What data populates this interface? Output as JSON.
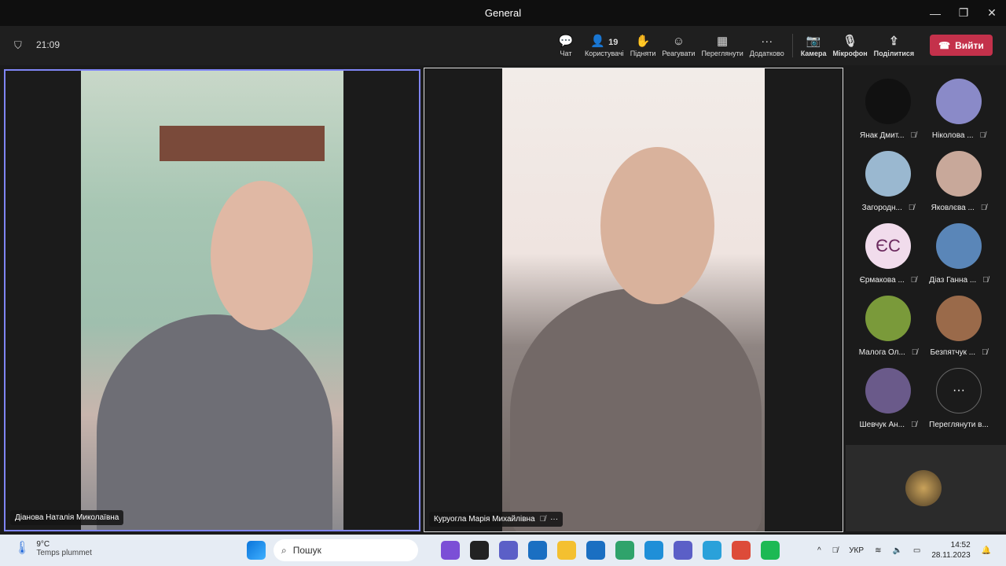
{
  "window": {
    "title": "General",
    "controls": [
      "—",
      "❐",
      "✕"
    ]
  },
  "header": {
    "timer": "21:09",
    "tools": [
      {
        "icon": "chat-icon",
        "glyph": "💬",
        "label": "Чат"
      },
      {
        "icon": "people-icon",
        "glyph": "👤",
        "badge": "19",
        "label": "Користувачі"
      },
      {
        "icon": "raise-hand-icon",
        "glyph": "✋",
        "label": "Підняти"
      },
      {
        "icon": "react-icon",
        "glyph": "☺",
        "label": "Реагувати"
      },
      {
        "icon": "view-icon",
        "glyph": "▦",
        "label": "Переглянути"
      },
      {
        "icon": "more-icon",
        "glyph": "···",
        "label": "Додатково"
      }
    ],
    "media": [
      {
        "icon": "camera-off-icon",
        "glyph": "📷",
        "label": "Камера"
      },
      {
        "icon": "mic-off-icon",
        "glyph": "🎙",
        "label": "Мікрофон"
      },
      {
        "icon": "share-icon",
        "glyph": "⇪",
        "label": "Поділитися"
      }
    ],
    "leave": "Вийти"
  },
  "tiles": [
    {
      "name": "Діанова Наталія Миколаївна"
    },
    {
      "name": "Куруогла Марія Михайлівна"
    }
  ],
  "participants": [
    {
      "name": "Янак Дмит...",
      "color": "#111"
    },
    {
      "name": "Ніколова ...",
      "color": "#8a8ac8"
    },
    {
      "name": "Загородн...",
      "color": "#9ab8d0"
    },
    {
      "name": "Яковлєва ...",
      "color": "#c8a89a"
    },
    {
      "name": "Єрмакова ...",
      "initials": "ЄС",
      "color": "#f1dcec"
    },
    {
      "name": "Діаз Ганна ...",
      "color": "#5a86b8"
    },
    {
      "name": "Малога Ол...",
      "color": "#7a9a3a"
    },
    {
      "name": "Безпятчук ...",
      "color": "#9a6a4a"
    },
    {
      "name": "Шевчук Ан...",
      "color": "#6a5a8a"
    },
    {
      "name": "Переглянути в...",
      "initials": "···",
      "color": "#1b1b1b"
    }
  ],
  "taskbar": {
    "temp": "9°C",
    "weather": "Temps plummet",
    "search": "Пошук",
    "lang": "УКР",
    "time": "14:52",
    "date": "28.11.2023",
    "apps": [
      "#7b4fd6",
      "#222",
      "#5b5fc7",
      "#1a6fc2",
      "#f4c030",
      "#1a6fc2",
      "#2fa36b",
      "#1f8fd8",
      "#5b5fc7",
      "#2aa1da",
      "#dd4b39",
      "#1db954"
    ]
  }
}
